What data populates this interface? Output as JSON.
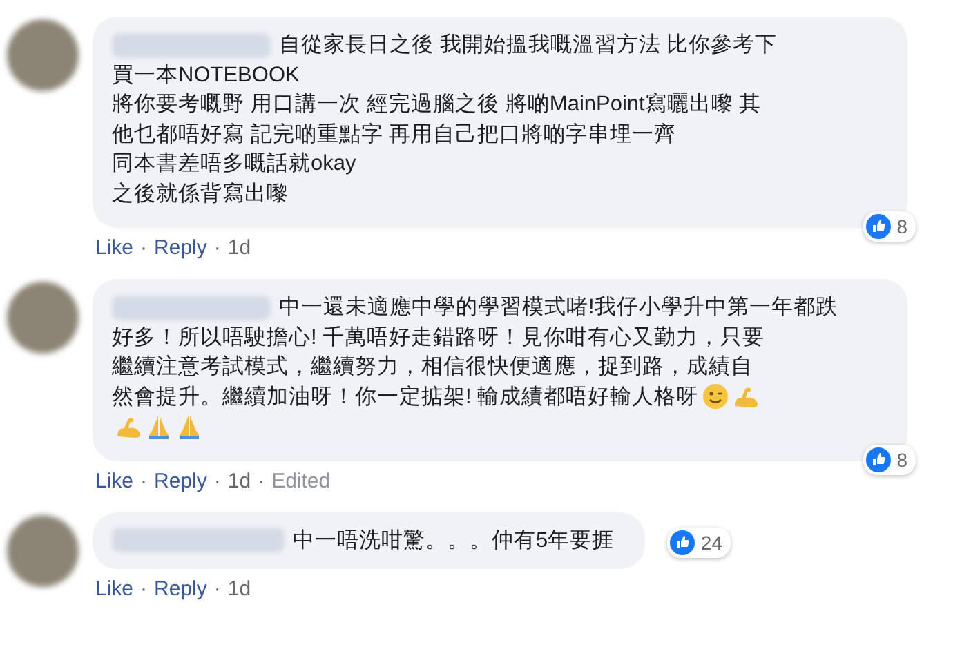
{
  "comments": [
    {
      "lines": [
        {
          "text": "自從家長日之後 我開始搵我嘅溫習方法 比你參考下"
        },
        {
          "text": "買一本NOTEBOOK"
        },
        {
          "text": "將你要考嘅野 用口講一次 經完過腦之後 將啲MainPoint寫曬出嚟 其"
        },
        {
          "text": "他乜都唔好寫 記完啲重點字 再用自己把口將啲字串埋一齊"
        },
        {
          "text": "同本書差唔多嘅話就okay"
        },
        {
          "text": "之後就係背寫出嚟"
        }
      ],
      "reactions": "8",
      "meta": [
        {
          "kind": "link",
          "text": "Like"
        },
        {
          "kind": "sep",
          "text": "·"
        },
        {
          "kind": "link",
          "text": "Reply"
        },
        {
          "kind": "sep",
          "text": "·"
        },
        {
          "kind": "time",
          "text": "1d"
        }
      ]
    },
    {
      "lines": [
        {
          "text": "中一還未適應中學的學習模式啫!我仔小學升中第一年都跌"
        },
        {
          "text": "好多！所以唔駛擔心! 千萬唔好走錯路呀！見你咁有心又勤力，只要"
        },
        {
          "text": "繼續注意考試模式，繼續努力，相信很快便適應，捉到路，成績自"
        },
        {
          "text": "然會提升。繼續加油呀！你一定掂架! 輸成績都唔好輸人格呀",
          "emojis": [
            {
              "kind": "wink"
            },
            {
              "kind": "muscle"
            }
          ]
        },
        {
          "emojis": [
            {
              "kind": "muscle"
            },
            {
              "kind": "pray"
            },
            {
              "kind": "pray"
            }
          ]
        }
      ],
      "reactions": "8",
      "meta": [
        {
          "kind": "link",
          "text": "Like"
        },
        {
          "kind": "sep",
          "text": "·"
        },
        {
          "kind": "link",
          "text": "Reply"
        },
        {
          "kind": "sep",
          "text": "·"
        },
        {
          "kind": "time",
          "text": "1d"
        },
        {
          "kind": "sep",
          "text": "·"
        },
        {
          "kind": "edited",
          "text": "Edited"
        }
      ]
    },
    {
      "lines": [
        {
          "text": "中一唔洗咁驚。。。仲有5年要捱"
        }
      ],
      "reactions": "24",
      "meta": [
        {
          "kind": "link",
          "text": "Like"
        },
        {
          "kind": "sep",
          "text": "·"
        },
        {
          "kind": "link",
          "text": "Reply"
        },
        {
          "kind": "sep",
          "text": "·"
        },
        {
          "kind": "time",
          "text": "1d"
        }
      ]
    }
  ]
}
